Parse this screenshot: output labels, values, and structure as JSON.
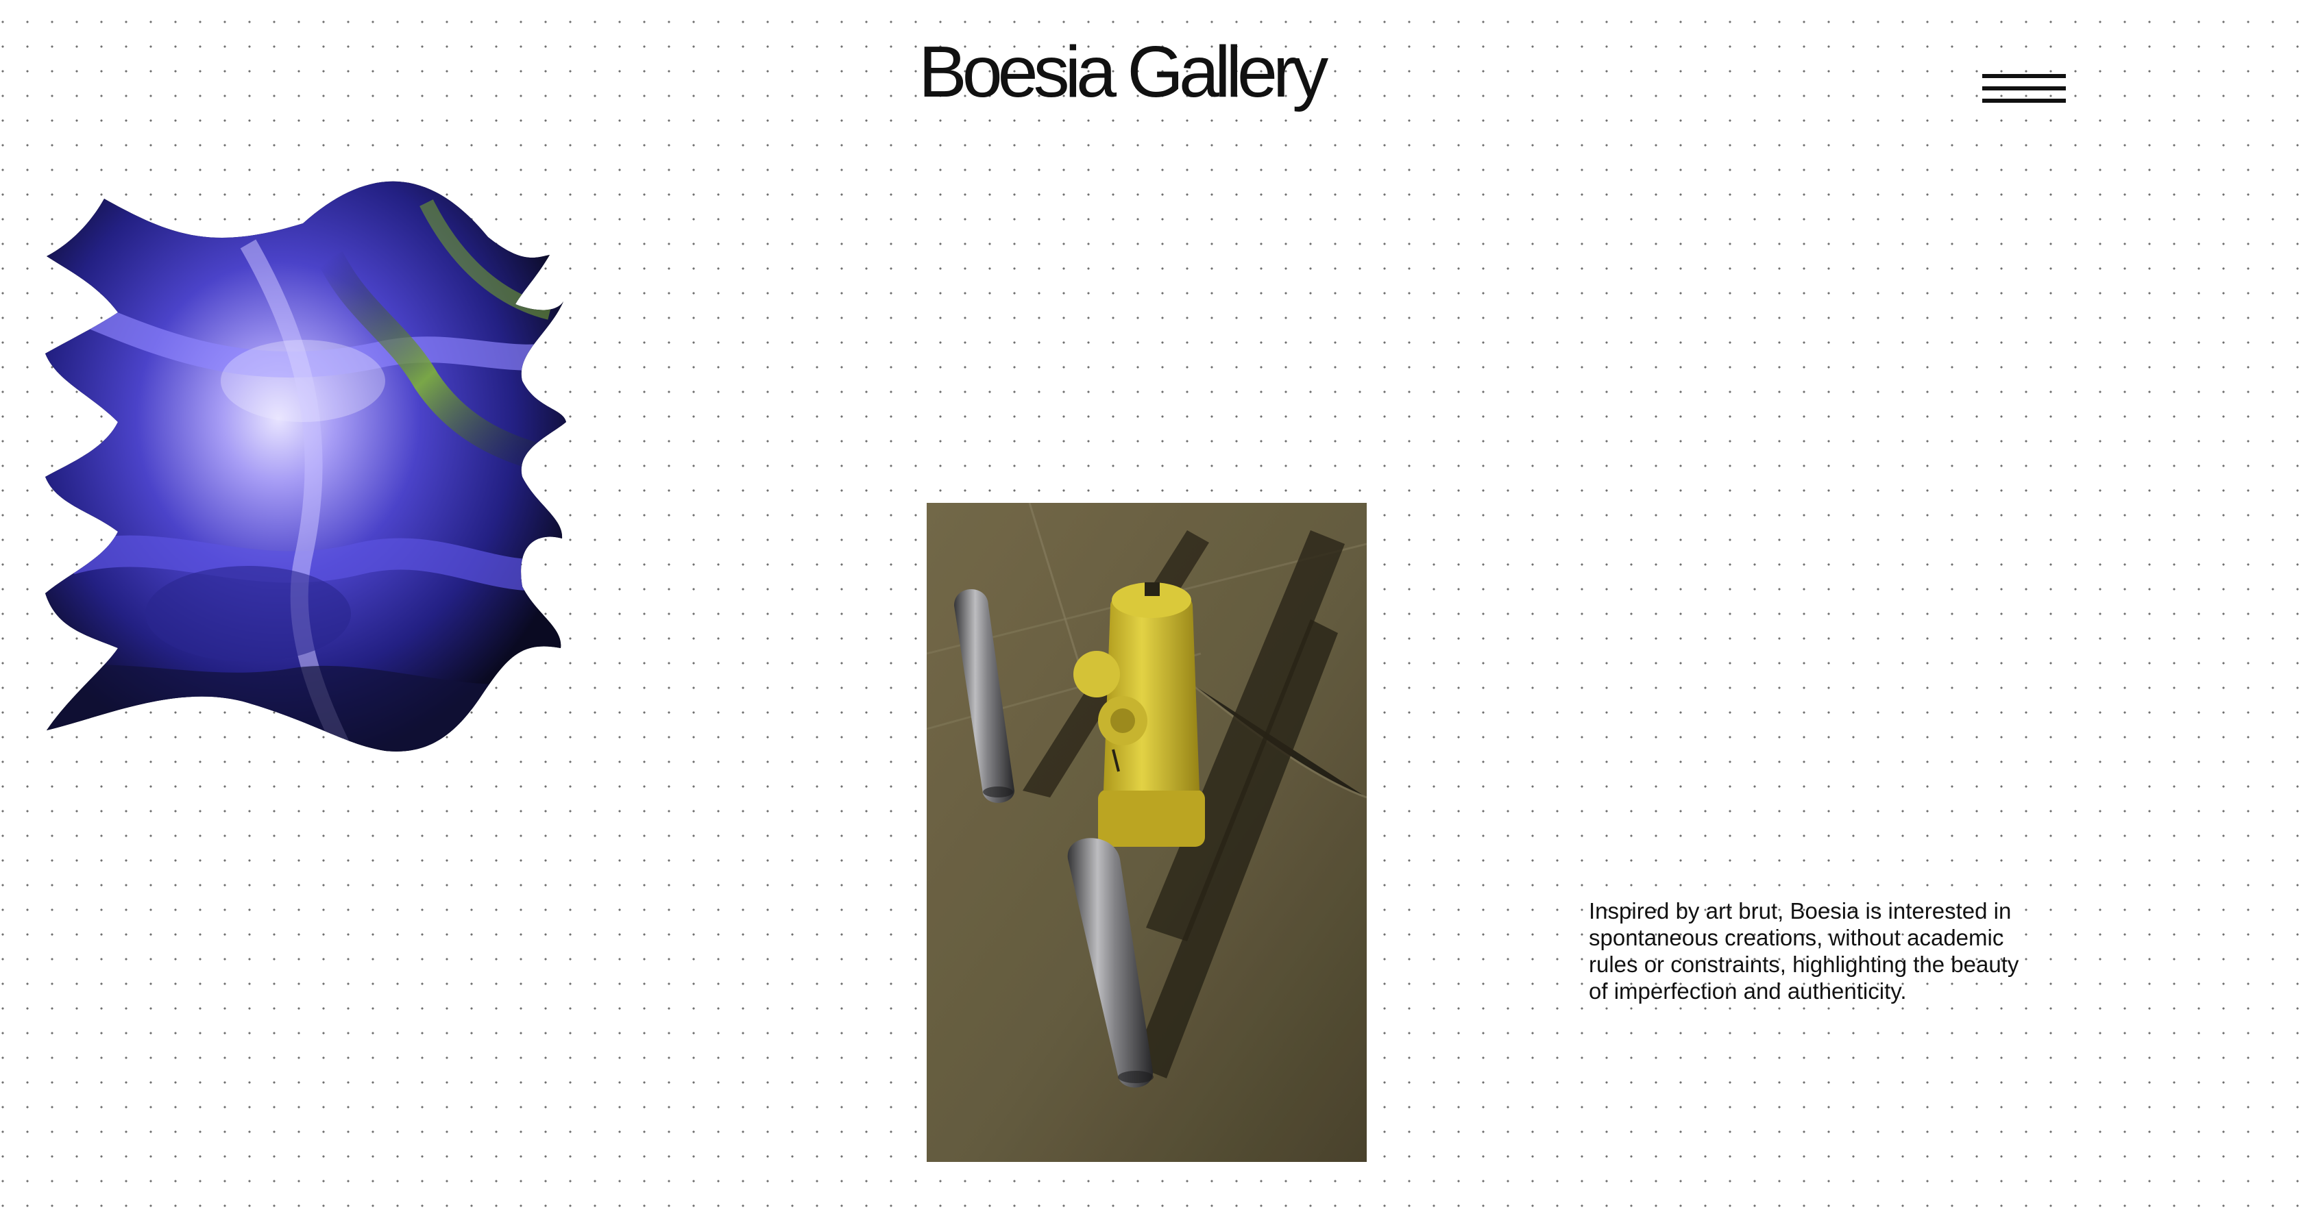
{
  "header": {
    "title": "Boesia Gallery",
    "menu_icon": "hamburger-menu-icon"
  },
  "artworks": [
    {
      "name": "abstract-blur-artwork",
      "colors": [
        "#2b2a8a",
        "#6c63e6",
        "#b7b0ff",
        "#7fb23a",
        "#0a0a14"
      ]
    },
    {
      "name": "yellow-fire-hydrant-photo",
      "colors": [
        "#6d6447",
        "#e5d23a",
        "#9a9aa0",
        "#1e1a12"
      ]
    }
  ],
  "about": {
    "text": "Inspired by art brut, Boesia is interested in spontaneous creations, without academic rules or constraints, highlighting the beauty of imperfection and authenticity."
  },
  "colors": {
    "background": "#ffffff",
    "dot": "#6f6f6f",
    "text": "#111111"
  }
}
